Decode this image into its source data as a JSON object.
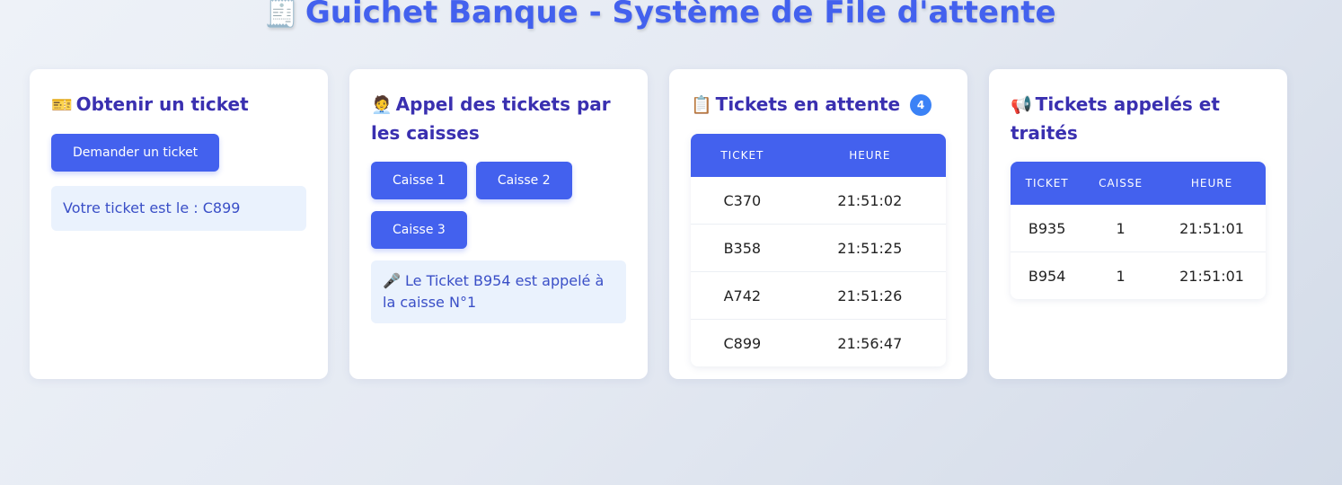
{
  "header": {
    "icon": "receipt-icon",
    "title": "Guichet Banque - Système de File d'attente"
  },
  "ticket_card": {
    "icon": "ticket-icon",
    "title": "Obtenir un ticket",
    "button_label": "Demander un ticket",
    "message": "Votre ticket est le : C899"
  },
  "call_card": {
    "icon": "office-worker-icon",
    "title": "Appel des tickets par les caisses",
    "buttons": [
      {
        "label": "Caisse 1"
      },
      {
        "label": "Caisse 2"
      },
      {
        "label": "Caisse 3"
      }
    ],
    "message": "🎤 Le Ticket B954 est appelé à la caisse N°1"
  },
  "waiting_card": {
    "icon": "clipboard-icon",
    "title": "Tickets en attente",
    "count": "4",
    "columns": [
      "TICKET",
      "HEURE"
    ],
    "rows": [
      [
        "C370",
        "21:51:02"
      ],
      [
        "B358",
        "21:51:25"
      ],
      [
        "A742",
        "21:51:26"
      ],
      [
        "C899",
        "21:56:47"
      ]
    ]
  },
  "called_card": {
    "icon": "megaphone-icon",
    "title": "Tickets appelés et traités",
    "columns": [
      "TICKET",
      "CAISSE",
      "HEURE"
    ],
    "rows": [
      [
        "B935",
        "1",
        "21:51:01"
      ],
      [
        "B954",
        "1",
        "21:51:01"
      ]
    ]
  },
  "colors": {
    "primary": "#4361ee",
    "title_text": "#3a30b0",
    "info_bg": "#eaf2fd",
    "badge": "#3b82f6"
  }
}
